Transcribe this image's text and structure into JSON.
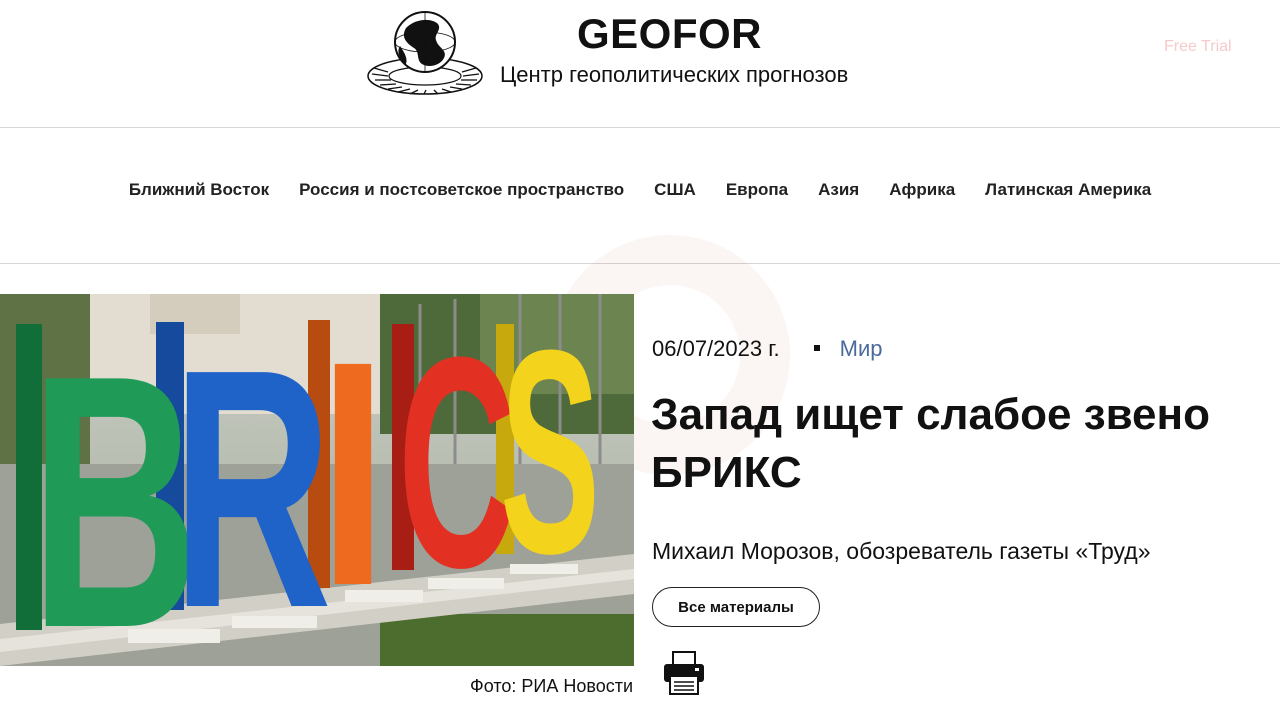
{
  "header": {
    "site_title": "GEOFOR",
    "site_subtitle": "Центр геополитических прогнозов",
    "free_trial": "Free Trial"
  },
  "nav": {
    "items": [
      "Ближний Восток",
      "Россия и постсоветское пространство",
      "США",
      "Европа",
      "Азия",
      "Африка",
      "Латинская Америка"
    ]
  },
  "article": {
    "date": "06/07/2023 г.",
    "category": "Мир",
    "title": "Запад ищет слабое звено БРИКС",
    "author": "Михаил Морозов, обозреватель газеты «Труд»",
    "all_materials_label": "Все материалы",
    "photo_credit": "Фото: РИА Новости",
    "photo_letters": [
      "B",
      "R",
      "I",
      "C",
      "S"
    ]
  },
  "colors": {
    "category_link": "#4a6a9c",
    "free_trial": "#f6caca",
    "letter_b": "#1f9a57",
    "letter_r": "#1f62c8",
    "letter_i": "#ee6a1e",
    "letter_c": "#e23022",
    "letter_s": "#f3d31b"
  },
  "icons": {
    "logo": "globe-logo-icon",
    "print": "printer-icon"
  }
}
